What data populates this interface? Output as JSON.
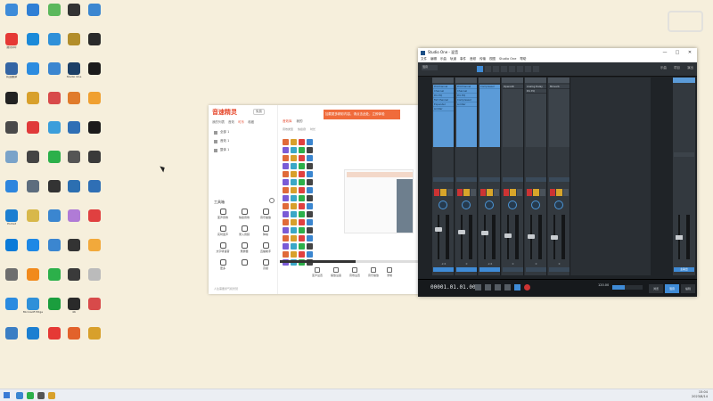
{
  "desktop": {
    "icons": [
      {
        "label": "",
        "color": "#3d8bd9"
      },
      {
        "label": "腾讯QQ",
        "color": "#e53935"
      },
      {
        "label": "有道翻译",
        "color": "#3465a4"
      },
      {
        "label": "",
        "color": "#222222"
      },
      {
        "label": "",
        "color": "#4a4a4a"
      },
      {
        "label": "",
        "color": "#7aa3c9"
      },
      {
        "label": "",
        "color": "#2e86de"
      },
      {
        "label": "Pocket",
        "color": "#1c7fd1"
      },
      {
        "label": "",
        "color": "#0b7bd8"
      },
      {
        "label": "",
        "color": "#6e6e6e"
      },
      {
        "label": "",
        "color": "#2a8be0"
      },
      {
        "label": "",
        "color": "#3b7ec4"
      },
      {
        "label": "",
        "color": "#2f7fd5"
      },
      {
        "label": "",
        "color": "#1b8ad9"
      },
      {
        "label": "",
        "color": "#2c8ce0"
      },
      {
        "label": "",
        "color": "#d8a02b"
      },
      {
        "label": "",
        "color": "#e03a3a"
      },
      {
        "label": "",
        "color": "#444444"
      },
      {
        "label": "",
        "color": "#5d6d7e"
      },
      {
        "label": "",
        "color": "#d8b84a"
      },
      {
        "label": "",
        "color": "#1e88e5"
      },
      {
        "label": "",
        "color": "#f18a1c"
      },
      {
        "label": "Microsoft Edge",
        "color": "#2f90d9"
      },
      {
        "label": "",
        "color": "#1c7fd1"
      },
      {
        "label": "",
        "color": "#5cb85c"
      },
      {
        "label": "",
        "color": "#2f90d9"
      },
      {
        "label": "",
        "color": "#3b86d0"
      },
      {
        "label": "",
        "color": "#d84a4a"
      },
      {
        "label": "",
        "color": "#3b9edb"
      },
      {
        "label": "",
        "color": "#2cb04a"
      },
      {
        "label": "",
        "color": "#333333"
      },
      {
        "label": "",
        "color": "#3b86d0"
      },
      {
        "label": "",
        "color": "#3b86d0"
      },
      {
        "label": "",
        "color": "#2cb04a"
      },
      {
        "label": "",
        "color": "#1b9e3e"
      },
      {
        "label": "",
        "color": "#e53935"
      },
      {
        "label": "",
        "color": "#333333"
      },
      {
        "label": "",
        "color": "#b28d2a"
      },
      {
        "label": "Studio One",
        "color": "#1c3f66"
      },
      {
        "label": "",
        "color": "#e07b2b"
      },
      {
        "label": "",
        "color": "#2f6fb5"
      },
      {
        "label": "",
        "color": "#555555"
      },
      {
        "label": "",
        "color": "#2c6fb1"
      },
      {
        "label": "",
        "color": "#b07bd6"
      },
      {
        "label": "",
        "color": "#333333"
      },
      {
        "label": "",
        "color": "#3a3a3a"
      },
      {
        "label": "4K",
        "color": "#2a2a2a"
      },
      {
        "label": "",
        "color": "#e2622b"
      },
      {
        "label": "",
        "color": "#3b86d0"
      },
      {
        "label": "",
        "color": "#2a2a2a"
      },
      {
        "label": "",
        "color": "#1b1b1b"
      },
      {
        "label": "",
        "color": "#f0a030"
      },
      {
        "label": "",
        "color": "#1b1b1b"
      },
      {
        "label": "",
        "color": "#3a3a3a"
      },
      {
        "label": "",
        "color": "#2f6fb5"
      },
      {
        "label": "",
        "color": "#e04040"
      },
      {
        "label": "",
        "color": "#f2a93b"
      },
      {
        "label": "",
        "color": "#bbbbbb"
      },
      {
        "label": "",
        "color": "#d84a4a"
      },
      {
        "label": "",
        "color": "#d8a02b"
      }
    ]
  },
  "watermark": {
    "line1": "",
    "line2": ""
  },
  "yinjie": {
    "logo": "音速精灵",
    "version": "免费",
    "tabs": [
      {
        "label": "我的列表",
        "active": false
      },
      {
        "label": "音效",
        "active": false
      },
      {
        "label": "可乐",
        "active": true
      },
      {
        "label": "收藏",
        "active": false
      }
    ],
    "lists": [
      {
        "label": "全部 1"
      },
      {
        "label": "音效 1"
      },
      {
        "label": "整体 1"
      }
    ],
    "tools_title": "工具箱",
    "tools": [
      {
        "label": "变声音效"
      },
      {
        "label": "快捷音效"
      },
      {
        "label": "音乐播放"
      },
      {
        "label": "实时变声"
      },
      {
        "label": "录入音频"
      },
      {
        "label": "降噪"
      },
      {
        "label": "文字转语音"
      },
      {
        "label": "录屏器"
      },
      {
        "label": "直播助手"
      },
      {
        "label": "更多"
      },
      {
        "label": ""
      },
      {
        "label": "高级"
      }
    ],
    "footer": "人生需要勇气和智慧",
    "banner": "加载更多精彩内容，请点击此处，立即体验",
    "sound_tabs": [
      {
        "label": "音效库",
        "active": true
      },
      {
        "label": "我的",
        "active": false
      }
    ],
    "sound_sub": [
      "音效类型",
      "快捷键",
      "时长"
    ],
    "actions": [
      {
        "label": "变声设置"
      },
      {
        "label": "播放设备"
      },
      {
        "label": "音效设置"
      },
      {
        "label": "音乐播放"
      },
      {
        "label": "录制"
      }
    ]
  },
  "studio_one": {
    "title": "Studio One - 混音",
    "window_controls": [
      "—",
      "□",
      "✕"
    ],
    "menu": [
      "文件",
      "编辑",
      "乐曲",
      "轨道",
      "事件",
      "音频",
      "传输",
      "视图",
      "Studio One",
      "帮助"
    ],
    "toolbar_select": "混音",
    "toolbar_right": [
      "乐曲",
      "项目",
      "演出"
    ],
    "strips": [
      {
        "header": "",
        "inserts": [
          "ProChannel",
          "Channel",
          "Pro EQ",
          "Fat Channel",
          "Expander",
          "Limiter"
        ],
        "name": "",
        "fader": 0.68,
        "meter": 0.0,
        "db": "-2.6",
        "foot": "",
        "selected": true
      },
      {
        "header": "",
        "inserts": [
          "ProChannel",
          "Channel",
          "Pro EQ",
          "Compressor",
          "Limiter"
        ],
        "name": "",
        "fader": 0.62,
        "meter": 0.0,
        "db": "0",
        "foot": "",
        "selected": true
      },
      {
        "header": "",
        "inserts": [
          "Compressor"
        ],
        "name": "",
        "fader": 0.6,
        "meter": 0.0,
        "db": "-2.6",
        "foot": "",
        "selected": true
      },
      {
        "header": "",
        "inserts": [
          "OpenAIR"
        ],
        "name": "",
        "fader": 0.55,
        "meter": 0.0,
        "db": "0",
        "foot": "",
        "selected": false
      },
      {
        "header": "",
        "inserts": [
          "Analog Delay",
          "Pro EQ"
        ],
        "name": "",
        "fader": 0.52,
        "meter": 0.0,
        "db": "0",
        "foot": "",
        "selected": false
      },
      {
        "header": "",
        "inserts": [
          "Mixverb"
        ],
        "name": "",
        "fader": 0.5,
        "meter": 0.0,
        "db": "0",
        "foot": "",
        "selected": false
      }
    ],
    "main_out": {
      "header": "",
      "output": "",
      "fader": 0.5,
      "meter": 0.0,
      "foot": "主输出"
    },
    "transport": {
      "time": "00001.01.01.00",
      "tempo": "120.00",
      "pages": [
        {
          "label": "浏览",
          "active": false
        },
        {
          "label": "混音",
          "active": true
        },
        {
          "label": "编辑",
          "active": false
        }
      ]
    }
  },
  "taskbar": {
    "time": "15:04",
    "date": "2023/8/14",
    "apps": [
      {
        "color": "#3b86d0"
      },
      {
        "color": "#2cb04a"
      },
      {
        "color": "#555555"
      },
      {
        "color": "#d8a02b"
      }
    ]
  }
}
